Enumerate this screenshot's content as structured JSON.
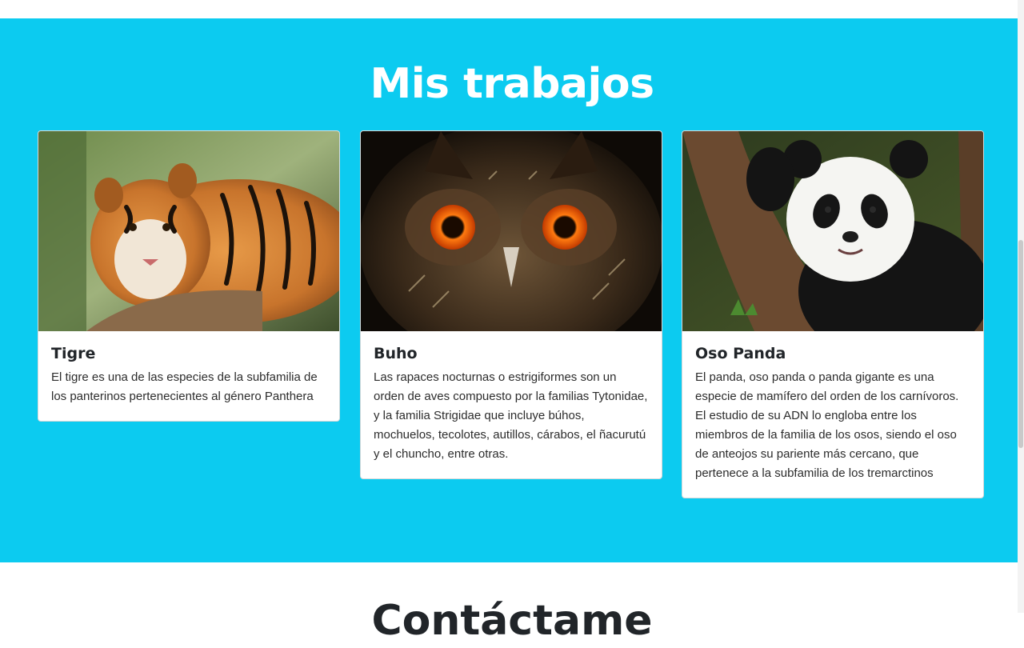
{
  "section": {
    "title": "Mis trabajos",
    "background_color": "#0ccbf0",
    "title_color": "#ffffff"
  },
  "cards": [
    {
      "title": "Tigre",
      "text": "El tigre es una de las especies de la subfamilia de los panterinos pertenecientes al género Panthera",
      "image": "tiger-photo"
    },
    {
      "title": "Buho",
      "text": "Las rapaces nocturnas o estrigiformes son un orden de aves compuesto por la familias Tytonidae, y la familia Strigidae que incluye búhos, mochuelos, tecolotes, autillos, cárabos, el ñacurutú y el chuncho, entre otras.",
      "image": "owl-photo"
    },
    {
      "title": "Oso Panda",
      "text": "El panda, oso panda o panda gigante es una especie de mamífero del orden de los carnívoros. El estudio de su ADN lo engloba entre los miembros de la familia de los osos, siendo el oso de anteojos su pariente más cercano, que pertenece a la subfamilia de los tremarctinos",
      "image": "panda-photo"
    }
  ],
  "next_section": {
    "title": "Contáctame"
  }
}
